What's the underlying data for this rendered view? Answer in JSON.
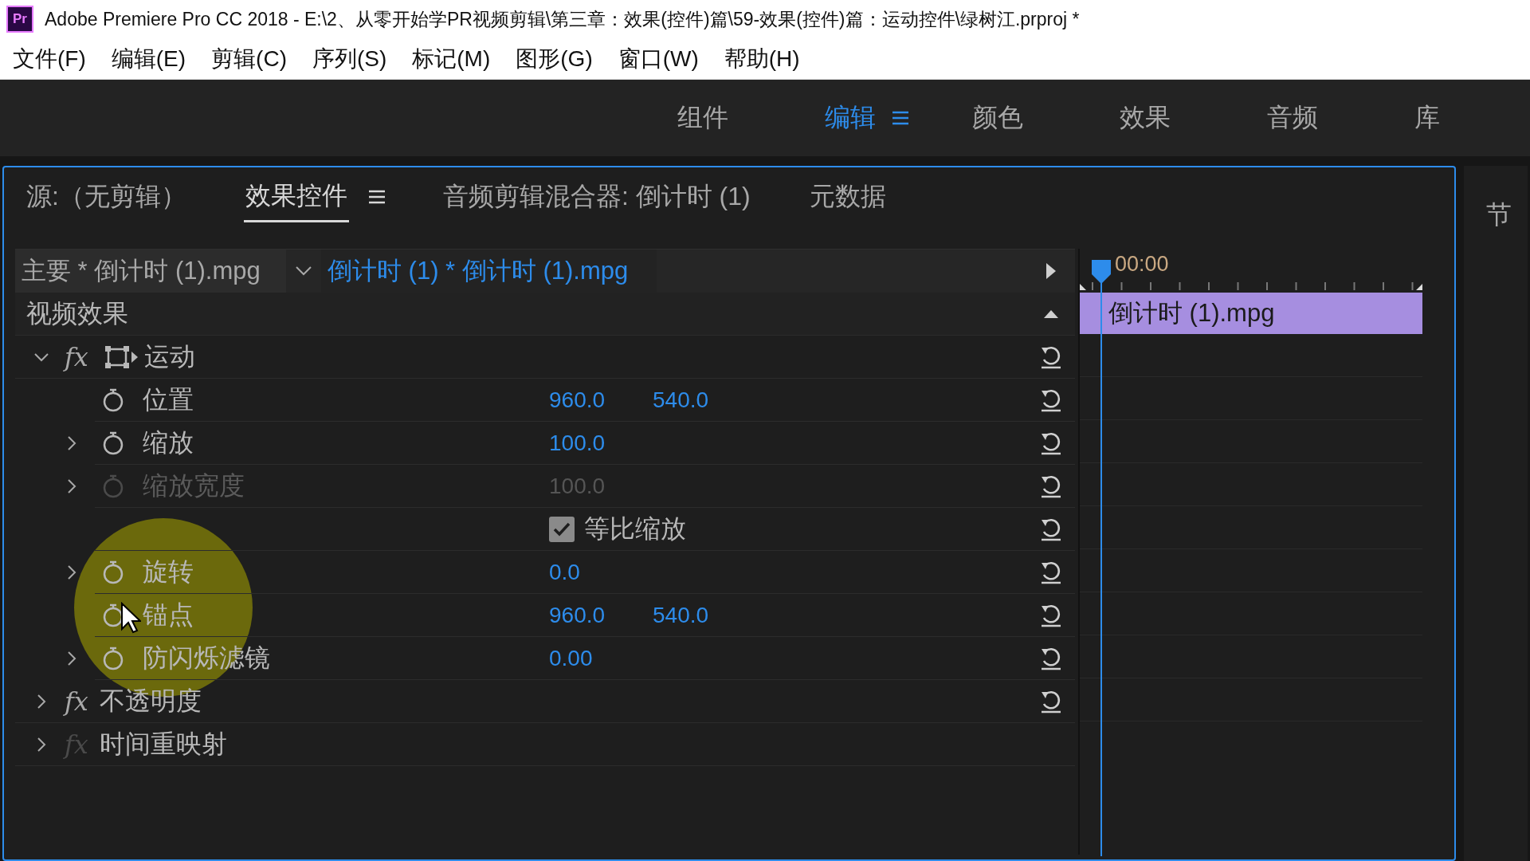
{
  "window": {
    "app_badge": "Pr",
    "title": "Adobe Premiere Pro CC 2018 - E:\\2、从零开始学PR视频剪辑\\第三章：效果(控件)篇\\59-效果(控件)篇：运动控件\\绿树江.prproj *"
  },
  "menu": [
    "文件(F)",
    "编辑(E)",
    "剪辑(C)",
    "序列(S)",
    "标记(M)",
    "图形(G)",
    "窗口(W)",
    "帮助(H)"
  ],
  "workspace_tabs": [
    {
      "label": "组件",
      "selected": false,
      "has_menu": false
    },
    {
      "label": "编辑",
      "selected": true,
      "has_menu": true
    },
    {
      "label": "颜色",
      "selected": false,
      "has_menu": false
    },
    {
      "label": "效果",
      "selected": false,
      "has_menu": false
    },
    {
      "label": "音频",
      "selected": false,
      "has_menu": false
    },
    {
      "label": "库",
      "selected": false,
      "has_menu": false
    }
  ],
  "panel_tabs": [
    {
      "label": "源:（无剪辑）",
      "selected": false,
      "has_menu": false
    },
    {
      "label": "效果控件",
      "selected": true,
      "has_menu": true
    },
    {
      "label": "音频剪辑混合器: 倒计时 (1)",
      "selected": false,
      "has_menu": false
    },
    {
      "label": "元数据",
      "selected": false,
      "has_menu": false
    }
  ],
  "effect_controls": {
    "source_clip": "主要 * 倒计时 (1).mpg",
    "target_clip": "倒计时 (1) * 倒计时 (1).mpg",
    "section": "视频效果",
    "effects": [
      {
        "kind": "motion",
        "badge": "fx",
        "name": "运动",
        "expanded": true,
        "fx_enabled": true,
        "resettable": true,
        "children": [
          {
            "kind": "param",
            "name": "位置",
            "expandable": false,
            "disabled": false,
            "values": [
              "960.0",
              "540.0"
            ]
          },
          {
            "kind": "param",
            "name": "缩放",
            "expandable": true,
            "disabled": false,
            "values": [
              "100.0"
            ]
          },
          {
            "kind": "param",
            "name": "缩放宽度",
            "expandable": true,
            "disabled": true,
            "values": [
              "100.0"
            ]
          },
          {
            "kind": "checkbox",
            "label": "等比缩放",
            "checked": true
          },
          {
            "kind": "param",
            "name": "旋转",
            "expandable": true,
            "disabled": false,
            "values": [
              "0.0"
            ]
          },
          {
            "kind": "param",
            "name": "锚点",
            "expandable": false,
            "disabled": false,
            "values": [
              "960.0",
              "540.0"
            ]
          },
          {
            "kind": "param",
            "name": "防闪烁滤镜",
            "expandable": true,
            "disabled": false,
            "values": [
              "0.00"
            ]
          }
        ]
      },
      {
        "kind": "standard",
        "badge": "fx",
        "name": "不透明度",
        "expanded": false,
        "fx_enabled": true,
        "resettable": true
      },
      {
        "kind": "standard",
        "badge": "fx",
        "name": "时间重映射",
        "expanded": false,
        "fx_enabled": false,
        "resettable": false
      }
    ]
  },
  "timeline": {
    "timecode": "00:00",
    "clip": "倒计时 (1).mpg"
  },
  "program_panel": {
    "title": "节"
  }
}
